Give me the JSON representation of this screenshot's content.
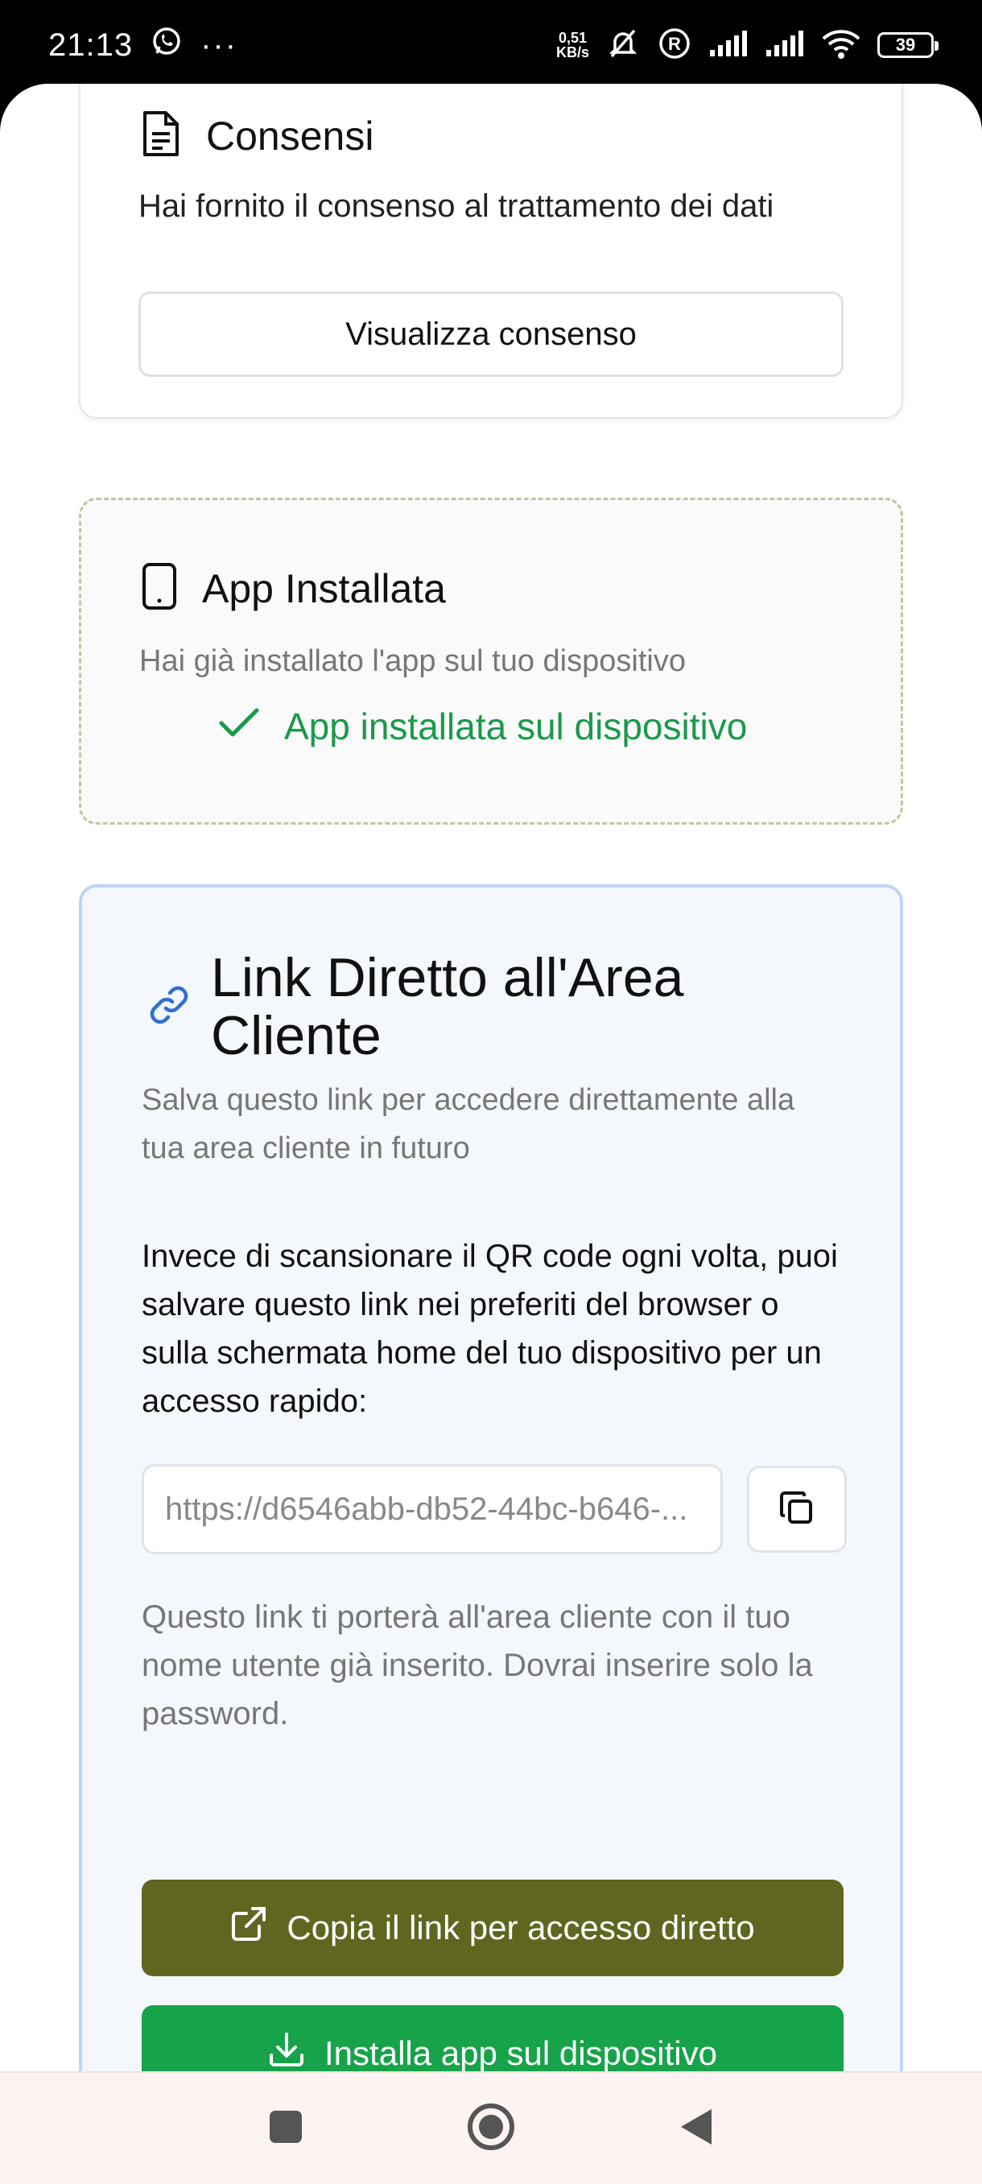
{
  "status_bar": {
    "time": "21:13",
    "net_speed_value": "0,51",
    "net_speed_unit": "KB/s",
    "battery": "39"
  },
  "consent_card": {
    "title": "Consensi",
    "text": "Hai fornito il consenso al trattamento dei dati",
    "button_label": "Visualizza consenso"
  },
  "app_card": {
    "title": "App Installata",
    "description": "Hai già installato l'app sul tuo dispositivo",
    "status": "App installata sul dispositivo"
  },
  "link_card": {
    "title": "Link Diretto all'Area Cliente",
    "description": "Salva questo link per accedere direttamente alla tua area cliente in futuro",
    "body": "Invece di scansionare il QR code ogni volta, puoi salvare questo link nei preferiti del browser o sulla schermata home del tuo dispositivo per un accesso rapido:",
    "url_value": "https://d6546abb-db52-44bc-b646-...",
    "note": "Questo link ti porterà all'area cliente con il tuo nome utente già inserito. Dovrai inserire solo la password.",
    "copy_button_label": "Copia il link per accesso diretto",
    "install_button_label": "Installa app sul dispositivo"
  },
  "colors": {
    "accent_green": "#16a34a",
    "olive_button": "#5f6620",
    "link_icon_blue": "#2f6fd6"
  }
}
